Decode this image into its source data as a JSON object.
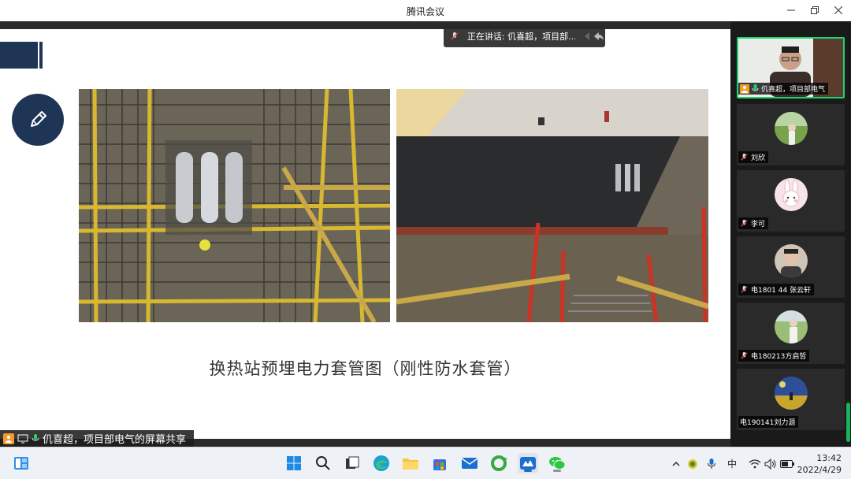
{
  "window": {
    "title": "腾讯会议"
  },
  "speaking_banner": {
    "text": "正在讲话: 仉喜超，项目部..."
  },
  "slide": {
    "caption": "换热站预埋电力套管图（刚性防水套管）"
  },
  "screen_share": {
    "label": "仉喜超，项目部电气的屏幕共享"
  },
  "participants": [
    {
      "name": "仉喜超，项目部电气",
      "active": true
    },
    {
      "name": "刘欣"
    },
    {
      "name": "李可"
    },
    {
      "name": "电1801 44 张云轩"
    },
    {
      "name": "电180213方启哲"
    },
    {
      "name": "电190141刘力源"
    }
  ],
  "taskbar": {
    "ime": "中",
    "time": "13:42",
    "date": "2022/4/29"
  },
  "colors": {
    "slide_accent": "#1e3556",
    "active_speaker_border": "#19d66e",
    "share_orange": "#f39a2b"
  }
}
